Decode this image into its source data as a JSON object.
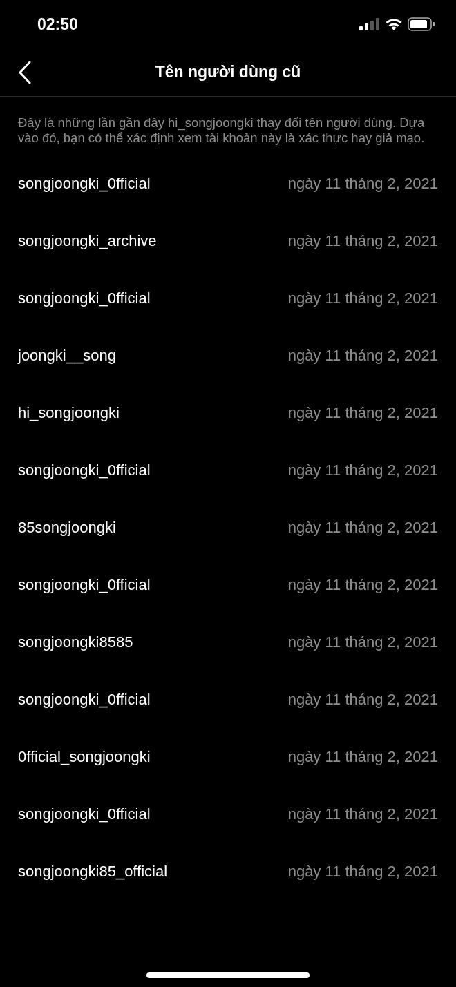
{
  "status_bar": {
    "time": "02:50"
  },
  "header": {
    "title": "Tên người dùng cũ"
  },
  "description": "Đây là những lần gần đây hi_songjoongki thay đổi tên người dùng. Dựa vào đó, bạn có thể xác định xem tài khoản này là xác thực hay giả mạo.",
  "usernames": [
    {
      "name": "songjoongki_0fficial",
      "date": "ngày 11 tháng 2, 2021"
    },
    {
      "name": "songjoongki_archive",
      "date": "ngày 11 tháng 2, 2021"
    },
    {
      "name": "songjoongki_0fficial",
      "date": "ngày 11 tháng 2, 2021"
    },
    {
      "name": "joongki__song",
      "date": "ngày 11 tháng 2, 2021"
    },
    {
      "name": "hi_songjoongki",
      "date": "ngày 11 tháng 2, 2021"
    },
    {
      "name": "songjoongki_0fficial",
      "date": "ngày 11 tháng 2, 2021"
    },
    {
      "name": "85songjoongki",
      "date": "ngày 11 tháng 2, 2021"
    },
    {
      "name": "songjoongki_0fficial",
      "date": "ngày 11 tháng 2, 2021"
    },
    {
      "name": "songjoongki8585",
      "date": "ngày 11 tháng 2, 2021"
    },
    {
      "name": "songjoongki_0fficial",
      "date": "ngày 11 tháng 2, 2021"
    },
    {
      "name": "0fficial_songjoongki",
      "date": "ngày 11 tháng 2, 2021"
    },
    {
      "name": "songjoongki_0fficial",
      "date": "ngày 11 tháng 2, 2021"
    },
    {
      "name": "songjoongki85_official",
      "date": "ngày 11 tháng 2, 2021"
    }
  ]
}
